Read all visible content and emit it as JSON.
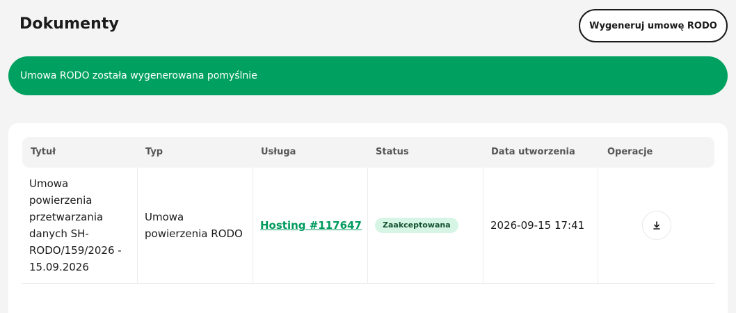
{
  "header": {
    "title": "Dokumenty",
    "generate_button_label": "Wygeneruj umowę RODO"
  },
  "alert": {
    "message": "Umowa RODO została wygenerowana pomyślnie",
    "color": "#00a160"
  },
  "table": {
    "columns": [
      "Tytuł",
      "Typ",
      "Usługa",
      "Status",
      "Data utworzenia",
      "Operacje"
    ],
    "rows": [
      {
        "title_lines": [
          "Umowa",
          "powierzenia",
          "przetwarzania",
          "danych SH-",
          "RODO/159/2026 -",
          "15.09.2026"
        ],
        "type_lines": [
          "Umowa",
          "powierzenia RODO"
        ],
        "service": "Hosting #117647",
        "status": "Zaakceptowana",
        "created": "2026-09-15 17:41",
        "operation_icon": "download-icon"
      }
    ]
  }
}
